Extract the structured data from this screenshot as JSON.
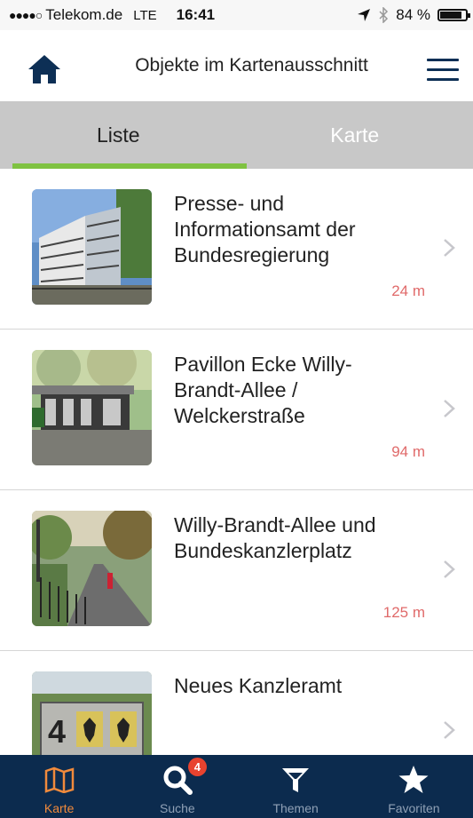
{
  "status_bar": {
    "signal": "●●●●○",
    "carrier": "Telekom.de",
    "network": "LTE",
    "time": "16:41",
    "battery": "84 %",
    "battery_level": 0.84
  },
  "nav": {
    "title": "Objekte im Kartenausschnitt"
  },
  "tabs": [
    {
      "label": "Liste",
      "active": true
    },
    {
      "label": "Karte",
      "active": false
    }
  ],
  "items": [
    {
      "title": "Presse- und Informationsamt der Bundesregierung",
      "distance": "24 m",
      "thumb": "office-building"
    },
    {
      "title": "Pavillon Ecke Willy-Brandt-Allee / Welckerstraße",
      "distance": "94 m",
      "thumb": "pavilion"
    },
    {
      "title": "Willy-Brandt-Allee und Bundeskanzlerplatz",
      "distance": "125 m",
      "thumb": "avenue"
    },
    {
      "title": "Neues Kanzleramt",
      "distance": "",
      "thumb": "chancellery-sign"
    }
  ],
  "tab_bar": [
    {
      "label": "Karte",
      "icon": "map-icon",
      "active": true
    },
    {
      "label": "Suche",
      "icon": "search-icon",
      "badge": "4"
    },
    {
      "label": "Themen",
      "icon": "filter-icon"
    },
    {
      "label": "Favoriten",
      "icon": "star-icon"
    }
  ],
  "colors": {
    "accent_green": "#7fc241",
    "distance_red": "#e06a6a",
    "navy": "#0c2b4e",
    "tab_active_orange": "#f08a3c",
    "badge_red": "#e8432f"
  }
}
